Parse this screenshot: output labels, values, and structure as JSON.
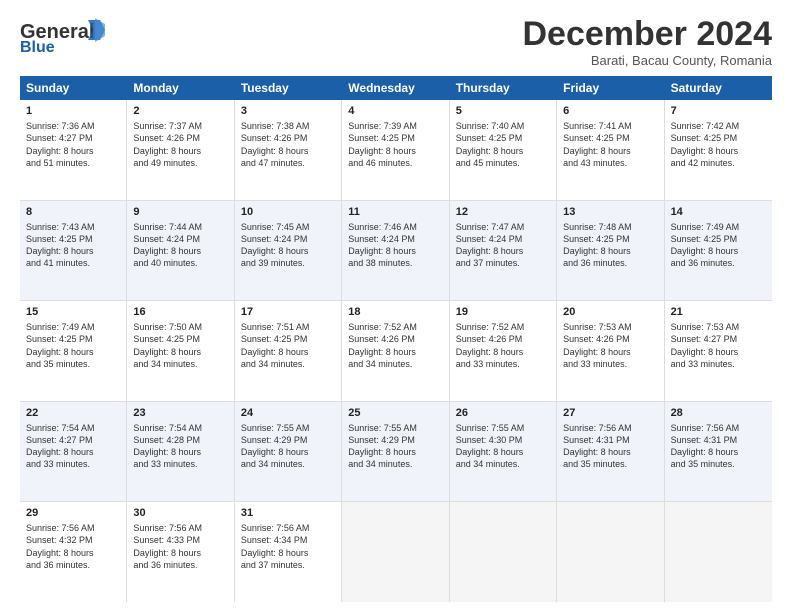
{
  "header": {
    "logo_line1": "General",
    "logo_line2": "Blue",
    "month": "December 2024",
    "location": "Barati, Bacau County, Romania"
  },
  "days": [
    "Sunday",
    "Monday",
    "Tuesday",
    "Wednesday",
    "Thursday",
    "Friday",
    "Saturday"
  ],
  "rows": [
    [
      {
        "day": "1",
        "info": "Sunrise: 7:36 AM\nSunset: 4:27 PM\nDaylight: 8 hours\nand 51 minutes."
      },
      {
        "day": "2",
        "info": "Sunrise: 7:37 AM\nSunset: 4:26 PM\nDaylight: 8 hours\nand 49 minutes."
      },
      {
        "day": "3",
        "info": "Sunrise: 7:38 AM\nSunset: 4:26 PM\nDaylight: 8 hours\nand 47 minutes."
      },
      {
        "day": "4",
        "info": "Sunrise: 7:39 AM\nSunset: 4:25 PM\nDaylight: 8 hours\nand 46 minutes."
      },
      {
        "day": "5",
        "info": "Sunrise: 7:40 AM\nSunset: 4:25 PM\nDaylight: 8 hours\nand 45 minutes."
      },
      {
        "day": "6",
        "info": "Sunrise: 7:41 AM\nSunset: 4:25 PM\nDaylight: 8 hours\nand 43 minutes."
      },
      {
        "day": "7",
        "info": "Sunrise: 7:42 AM\nSunset: 4:25 PM\nDaylight: 8 hours\nand 42 minutes."
      }
    ],
    [
      {
        "day": "8",
        "info": "Sunrise: 7:43 AM\nSunset: 4:25 PM\nDaylight: 8 hours\nand 41 minutes."
      },
      {
        "day": "9",
        "info": "Sunrise: 7:44 AM\nSunset: 4:24 PM\nDaylight: 8 hours\nand 40 minutes."
      },
      {
        "day": "10",
        "info": "Sunrise: 7:45 AM\nSunset: 4:24 PM\nDaylight: 8 hours\nand 39 minutes."
      },
      {
        "day": "11",
        "info": "Sunrise: 7:46 AM\nSunset: 4:24 PM\nDaylight: 8 hours\nand 38 minutes."
      },
      {
        "day": "12",
        "info": "Sunrise: 7:47 AM\nSunset: 4:24 PM\nDaylight: 8 hours\nand 37 minutes."
      },
      {
        "day": "13",
        "info": "Sunrise: 7:48 AM\nSunset: 4:25 PM\nDaylight: 8 hours\nand 36 minutes."
      },
      {
        "day": "14",
        "info": "Sunrise: 7:49 AM\nSunset: 4:25 PM\nDaylight: 8 hours\nand 36 minutes."
      }
    ],
    [
      {
        "day": "15",
        "info": "Sunrise: 7:49 AM\nSunset: 4:25 PM\nDaylight: 8 hours\nand 35 minutes."
      },
      {
        "day": "16",
        "info": "Sunrise: 7:50 AM\nSunset: 4:25 PM\nDaylight: 8 hours\nand 34 minutes."
      },
      {
        "day": "17",
        "info": "Sunrise: 7:51 AM\nSunset: 4:25 PM\nDaylight: 8 hours\nand 34 minutes."
      },
      {
        "day": "18",
        "info": "Sunrise: 7:52 AM\nSunset: 4:26 PM\nDaylight: 8 hours\nand 34 minutes."
      },
      {
        "day": "19",
        "info": "Sunrise: 7:52 AM\nSunset: 4:26 PM\nDaylight: 8 hours\nand 33 minutes."
      },
      {
        "day": "20",
        "info": "Sunrise: 7:53 AM\nSunset: 4:26 PM\nDaylight: 8 hours\nand 33 minutes."
      },
      {
        "day": "21",
        "info": "Sunrise: 7:53 AM\nSunset: 4:27 PM\nDaylight: 8 hours\nand 33 minutes."
      }
    ],
    [
      {
        "day": "22",
        "info": "Sunrise: 7:54 AM\nSunset: 4:27 PM\nDaylight: 8 hours\nand 33 minutes."
      },
      {
        "day": "23",
        "info": "Sunrise: 7:54 AM\nSunset: 4:28 PM\nDaylight: 8 hours\nand 33 minutes."
      },
      {
        "day": "24",
        "info": "Sunrise: 7:55 AM\nSunset: 4:29 PM\nDaylight: 8 hours\nand 34 minutes."
      },
      {
        "day": "25",
        "info": "Sunrise: 7:55 AM\nSunset: 4:29 PM\nDaylight: 8 hours\nand 34 minutes."
      },
      {
        "day": "26",
        "info": "Sunrise: 7:55 AM\nSunset: 4:30 PM\nDaylight: 8 hours\nand 34 minutes."
      },
      {
        "day": "27",
        "info": "Sunrise: 7:56 AM\nSunset: 4:31 PM\nDaylight: 8 hours\nand 35 minutes."
      },
      {
        "day": "28",
        "info": "Sunrise: 7:56 AM\nSunset: 4:31 PM\nDaylight: 8 hours\nand 35 minutes."
      }
    ],
    [
      {
        "day": "29",
        "info": "Sunrise: 7:56 AM\nSunset: 4:32 PM\nDaylight: 8 hours\nand 36 minutes."
      },
      {
        "day": "30",
        "info": "Sunrise: 7:56 AM\nSunset: 4:33 PM\nDaylight: 8 hours\nand 36 minutes."
      },
      {
        "day": "31",
        "info": "Sunrise: 7:56 AM\nSunset: 4:34 PM\nDaylight: 8 hours\nand 37 minutes."
      },
      {
        "day": "",
        "info": ""
      },
      {
        "day": "",
        "info": ""
      },
      {
        "day": "",
        "info": ""
      },
      {
        "day": "",
        "info": ""
      }
    ]
  ]
}
